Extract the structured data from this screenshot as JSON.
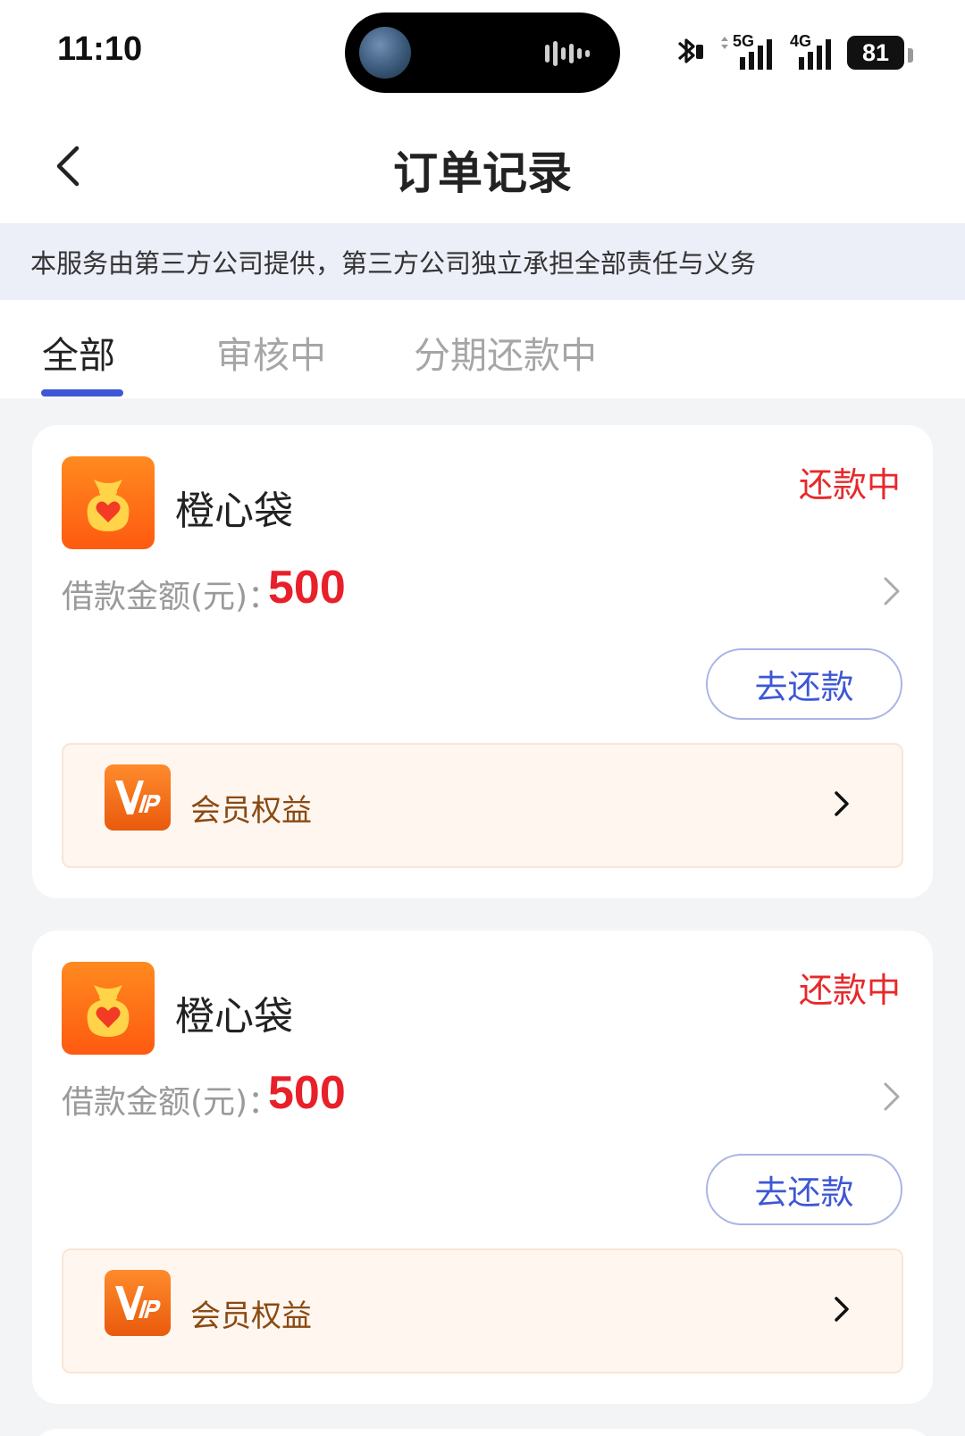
{
  "status_bar": {
    "time": "11:10",
    "network_1": "5G",
    "network_2": "4G",
    "battery": "81"
  },
  "header": {
    "title": "订单记录"
  },
  "notice": {
    "text": "本服务由第三方公司提供，第三方公司独立承担全部责任与义务"
  },
  "tabs": [
    {
      "label": "全部",
      "active": true
    },
    {
      "label": "审核中",
      "active": false
    },
    {
      "label": "分期还款中",
      "active": false
    }
  ],
  "orders": [
    {
      "app_name": "橙心袋",
      "status": "还款中",
      "amount_label": "借款金额(元)：",
      "amount": "500",
      "repay_button": "去还款",
      "vip_label": "会员权益"
    },
    {
      "app_name": "橙心袋",
      "status": "还款中",
      "amount_label": "借款金额(元)：",
      "amount": "500",
      "repay_button": "去还款",
      "vip_label": "会员权益"
    }
  ],
  "colors": {
    "accent": "#3d57d6",
    "status_red": "#e8282b",
    "logo_orange": "#fe6a14",
    "vip_text": "#8a4a12"
  },
  "icons": {
    "back": "chevron-left-icon",
    "app_logo": "money-bag-heart-icon",
    "vip": "vip-badge-icon",
    "detail": "chevron-right-icon"
  }
}
